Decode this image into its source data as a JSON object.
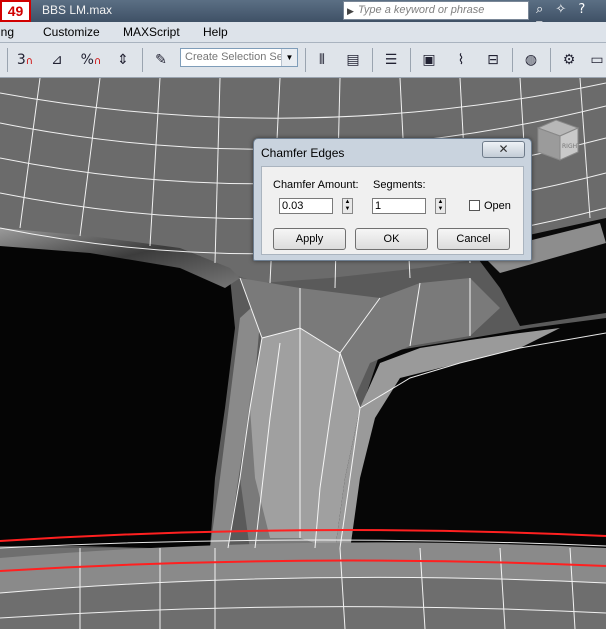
{
  "window": {
    "badge": "49",
    "title": "BBS LM.max",
    "search_placeholder": "Type a keyword or phrase",
    "title_icons": "⌕ ✧ ? ▾"
  },
  "menu": {
    "items": [
      "ring",
      "Customize",
      "MAXScript",
      "Help"
    ]
  },
  "toolbar": {
    "selection_set": "Create Selection Se",
    "snap_3": "3",
    "percent": "%"
  },
  "viewcube": {
    "label": "RIGHT"
  },
  "dialog": {
    "title": "Chamfer Edges",
    "close_glyph": "✕",
    "chamfer_amount_label": "Chamfer Amount:",
    "chamfer_amount_value": "0.03",
    "segments_label": "Segments:",
    "segments_value": "1",
    "open_label": "Open",
    "open_checked": false,
    "apply_label": "Apply",
    "ok_label": "OK",
    "cancel_label": "Cancel"
  },
  "colors": {
    "selection_edge": "#ff2020",
    "wire": "#ffffff"
  }
}
